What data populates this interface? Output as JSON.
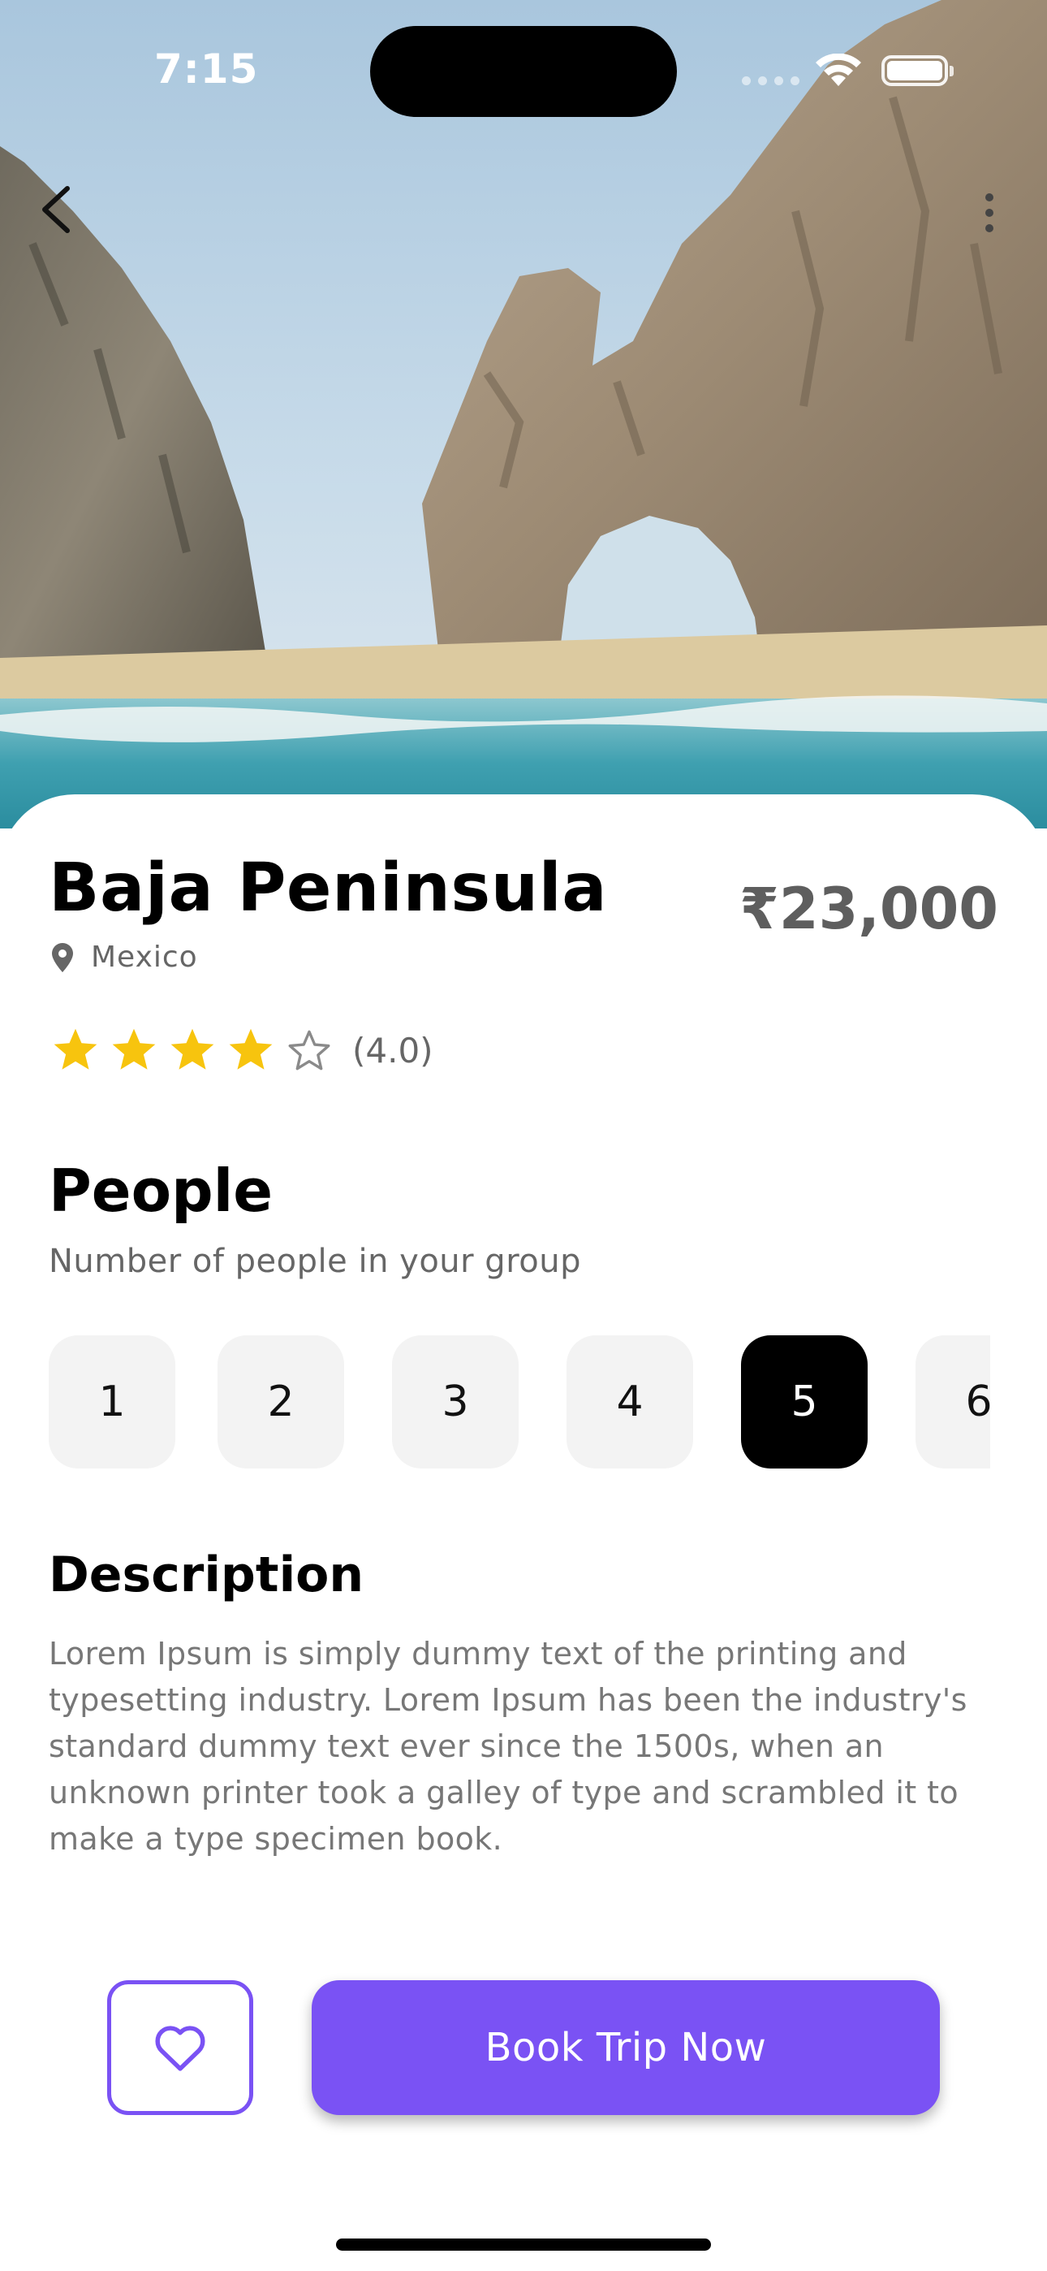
{
  "status_bar": {
    "time": "7:15"
  },
  "place": {
    "name": "Baja Peninsula",
    "location": "Mexico",
    "price": "₹23,000",
    "rating_text": "(4.0)",
    "rating_value": 4,
    "rating_max": 5
  },
  "people": {
    "heading": "People",
    "subtitle": "Number of people in your group",
    "options": [
      "1",
      "2",
      "3",
      "4",
      "5",
      "6"
    ],
    "selected": "5"
  },
  "description": {
    "heading": "Description",
    "text": "Lorem Ipsum is simply dummy text of the printing and typesetting industry. Lorem Ipsum has been the industry's standard dummy text ever since the 1500s, when an unknown printer took a galley of type and scrambled it to make a type specimen book."
  },
  "actions": {
    "book_label": "Book Trip Now"
  },
  "icons": {
    "back": "chevron-left-icon",
    "more": "more-vertical-icon",
    "location": "map-pin-icon",
    "star": "star-icon",
    "favorite": "heart-icon"
  },
  "colors": {
    "accent": "#7a52f4",
    "star_filled": "#f7c40e",
    "star_empty": "#8a8a8a",
    "chip_selected": "#000000",
    "chip_default": "#f3f3f3"
  }
}
